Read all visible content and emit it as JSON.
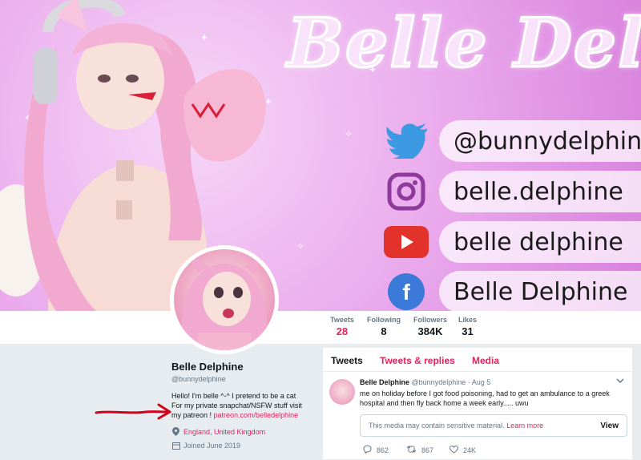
{
  "banner": {
    "script_title": "Belle Delph",
    "socials": [
      {
        "icon": "twitter-bird-icon",
        "label": "@bunnydelphine",
        "color": "#3b9ae1"
      },
      {
        "icon": "instagram-icon",
        "label": "belle.delphine",
        "color": "#8e3a9d"
      },
      {
        "icon": "youtube-icon",
        "label": "belle delphine",
        "color": "#e3322c"
      },
      {
        "icon": "facebook-icon",
        "label": "Belle Delphine",
        "color": "#3b7ad8"
      }
    ]
  },
  "stats": [
    {
      "label": "Tweets",
      "value": "28"
    },
    {
      "label": "Following",
      "value": "8"
    },
    {
      "label": "Followers",
      "value": "384K"
    },
    {
      "label": "Likes",
      "value": "31"
    }
  ],
  "profile": {
    "name": "Belle Delphine",
    "handle": "@bunnydelphine",
    "bio_line1": "Hello! I'm belle ^-^ I pretend to be a cat",
    "bio_line2": "For my private snapchat/NSFW stuff visit",
    "bio_line3": "my patreon ! ",
    "bio_link": "patreon.com/belledelphine",
    "location": "England, United Kingdom",
    "joined": "Joined June 2019"
  },
  "timeline": {
    "tabs": [
      "Tweets",
      "Tweets & replies",
      "Media"
    ],
    "tweet": {
      "name": "Belle Delphine",
      "handle": "@bunnydelphine",
      "separator": "·",
      "date": "Aug 5",
      "text": "me on holiday before I got food poisoning, had to get an ambulance to a greek hospital and then fly back home a week early..... uwu",
      "sensitive_text": "This media may contain sensitive material.",
      "sensitive_link": "Learn more",
      "view_label": "View",
      "replies": "862",
      "retweets": "867",
      "likes": "24K"
    }
  },
  "colors": {
    "accent": "#e0245e",
    "banner_pink": "#e9a8ec",
    "annotation_arrow": "#d0021b"
  }
}
